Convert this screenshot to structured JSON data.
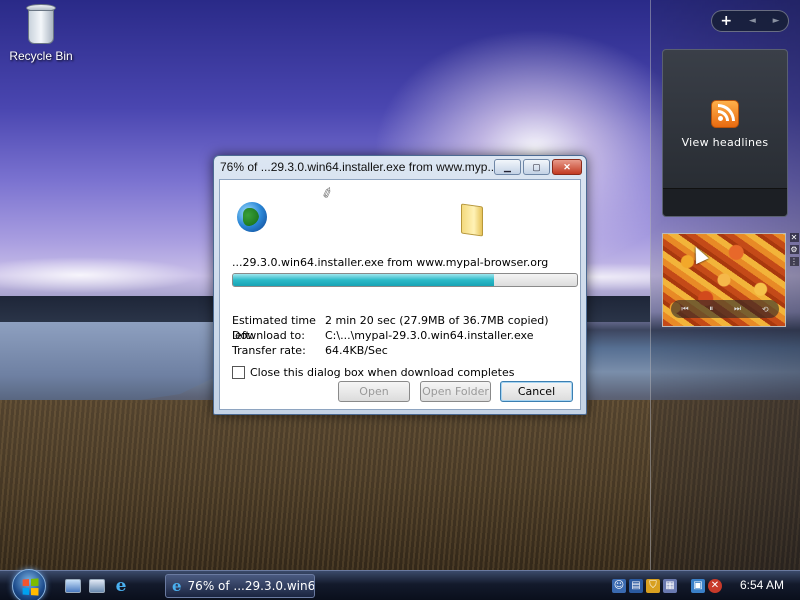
{
  "desktop": {
    "icons": [
      {
        "label": "Recycle Bin",
        "icon": "recycle-bin-icon"
      }
    ]
  },
  "sidebar": {
    "controls": {
      "add": "+",
      "prev": "◄",
      "next": "►"
    },
    "feed_gadget": {
      "label": "View headlines",
      "icon": "rss-icon"
    },
    "slideshow_gadget": {
      "controls": [
        "⏮",
        "⏸",
        "⏭",
        "⟲"
      ]
    }
  },
  "dialog": {
    "title": "76% of ...29.3.0.win64.installer.exe from www.myp...",
    "source_line": "...29.3.0.win64.installer.exe from www.mypal-browser.org",
    "progress_fraction": 0.76,
    "fields": [
      {
        "label": "Estimated time left:",
        "value": "2 min 20 sec (27.9MB of 36.7MB copied)"
      },
      {
        "label": "Download to:",
        "value": "C:\\...\\mypal-29.3.0.win64.installer.exe"
      },
      {
        "label": "Transfer rate:",
        "value": "64.4KB/Sec"
      }
    ],
    "close_when_done": {
      "label": "Close this dialog box when download completes",
      "checked": false
    },
    "buttons": {
      "open": "Open",
      "open_folder": "Open Folder",
      "cancel": "Cancel"
    }
  },
  "taskbar": {
    "task_button": "76% of ...29.3.0.win6...",
    "clock": "6:54 AM"
  }
}
